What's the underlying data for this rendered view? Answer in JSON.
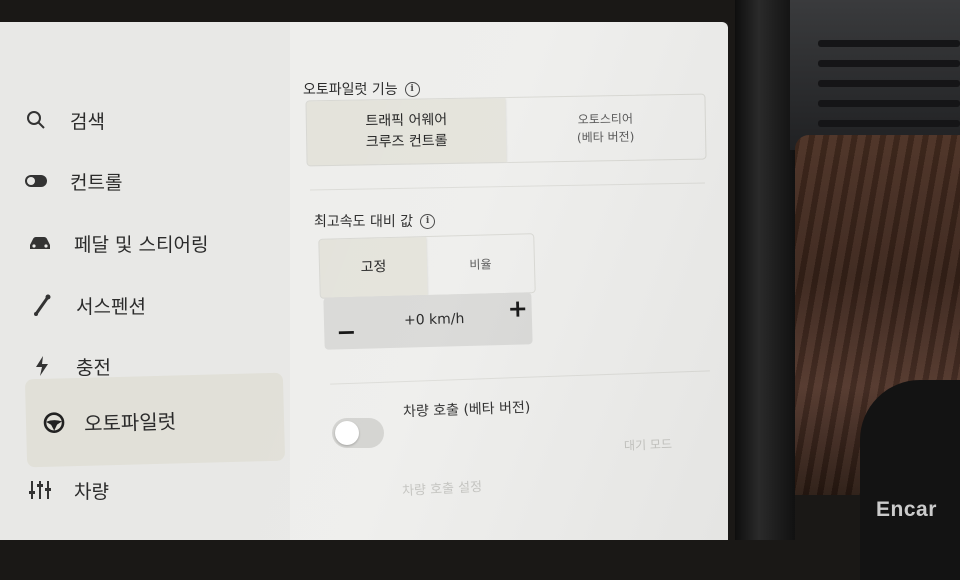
{
  "sidebar": {
    "items": [
      {
        "label": "검색",
        "icon": "search-icon"
      },
      {
        "label": "컨트롤",
        "icon": "toggle-icon"
      },
      {
        "label": "페달 및 스티어링",
        "icon": "car-icon"
      },
      {
        "label": "서스펜션",
        "icon": "suspension-icon"
      },
      {
        "label": "충전",
        "icon": "bolt-icon"
      },
      {
        "label": "오토파일럿",
        "icon": "steering-wheel-icon",
        "active": true
      },
      {
        "label": "차량",
        "icon": "sliders-icon"
      }
    ]
  },
  "autopilot": {
    "features_title": "오토파일럿 기능",
    "option_tacc": "트래픽 어웨어\n크루즈 컨트롤",
    "option_autosteer": "오토스티어\n(베타 버전)",
    "speed_offset_title": "최고속도 대비 값",
    "offset_fixed": "고정",
    "offset_ratio": "비율",
    "stepper_value": "+0 km/h",
    "stepper_minus": "−",
    "stepper_plus": "+",
    "summon_title": "차량 호출 (베타 버전)",
    "summon_standby": "대기 모드",
    "summon_settings": "차량 호출 설정",
    "summon_enabled": false
  },
  "watermark": "Encar",
  "colors": {
    "screen_bg": "#eeeeec",
    "sidebar_bg": "#e8e8e6",
    "active_item_bg": "#e1e0d8",
    "stepper_bg": "#d9d9d7"
  }
}
